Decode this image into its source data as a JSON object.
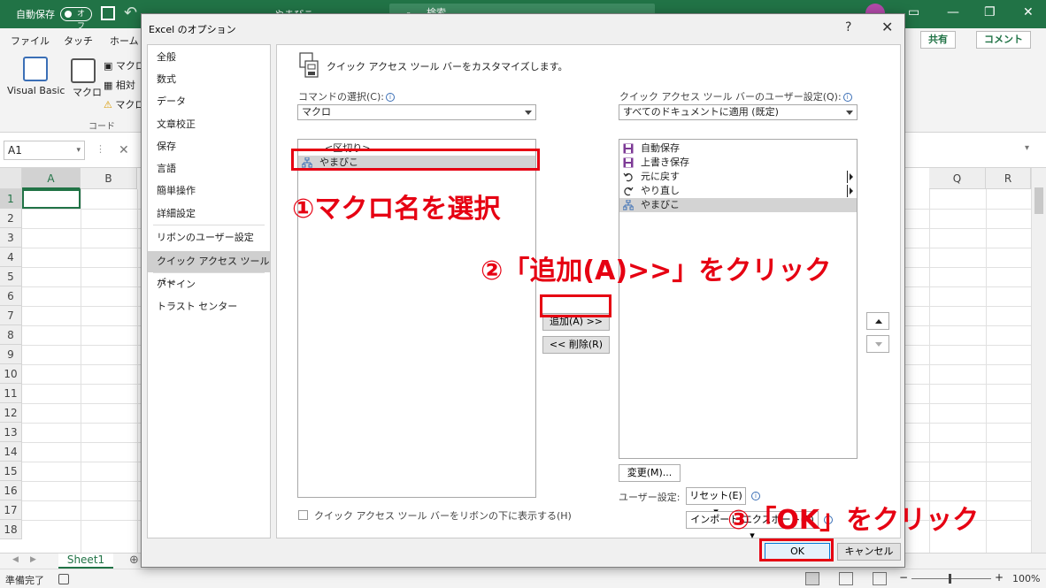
{
  "excel": {
    "autosave_label": "自動保存",
    "autosave_state": "オフ",
    "document_name": "やまびこ",
    "search_placeholder": "検索",
    "ribbon_tabs": [
      "ファイル",
      "タッチ",
      "ホーム"
    ],
    "share_label": "共有",
    "comment_label": "コメント",
    "ribbon_items": {
      "visual_basic": "Visual Basic",
      "macro": "マクロ",
      "macro_record": "マクロ",
      "relative": "相対",
      "macro_security": "マクロ"
    },
    "group_label": "コード",
    "name_box": "A1",
    "columns": [
      "A",
      "B",
      "Q",
      "R"
    ],
    "rows": [
      "1",
      "2",
      "3",
      "4",
      "5",
      "6",
      "7",
      "8",
      "9",
      "10",
      "11",
      "12",
      "13",
      "14",
      "15",
      "16",
      "17",
      "18"
    ],
    "sheet_tab": "Sheet1",
    "status_text": "準備完了",
    "zoom_level": "100%"
  },
  "dialog": {
    "title": "Excel のオプション",
    "help_glyph": "?",
    "close_glyph": "✕",
    "nav_items": [
      "全般",
      "数式",
      "データ",
      "文章校正",
      "保存",
      "言語",
      "簡単操作",
      "詳細設定",
      "リボンのユーザー設定",
      "クイック アクセス ツール バー",
      "アドイン",
      "トラスト センター"
    ],
    "active_nav": "クイック アクセス ツール バー",
    "heading": "クイック アクセス ツール バーをカスタマイズします。",
    "choose_commands_label": "コマンドの選択(C):",
    "choose_commands_value": "マクロ",
    "customize_label": "クイック アクセス ツール バーのユーザー設定(Q):",
    "customize_value": "すべてのドキュメントに適用 (既定)",
    "left_list": [
      {
        "text": "<区切り>",
        "icon": "none"
      },
      {
        "text": "やまびこ",
        "icon": "macro-icon"
      }
    ],
    "right_list": [
      {
        "text": "自動保存",
        "icon": "save-icon"
      },
      {
        "text": "上書き保存",
        "icon": "save-icon"
      },
      {
        "text": "元に戻す",
        "icon": "undo-icon"
      },
      {
        "text": "やり直し",
        "icon": "redo-icon"
      },
      {
        "text": "やまびこ",
        "icon": "macro-icon"
      }
    ],
    "add_button": "追加(A) >>",
    "remove_button": "<< 削除(R)",
    "modify_button": "変更(M)...",
    "user_settings_label": "ユーザー設定:",
    "reset_button": "リセット(E) ▾",
    "import_export_button": "インポート/エクスポート(P) ▾",
    "show_below_ribbon_label": "クイック アクセス ツール バーをリボンの下に表示する(H)",
    "ok_button": "OK",
    "cancel_button": "キャンセル"
  },
  "annotations": {
    "step1": "①マクロ名を選択",
    "step2": "②「追加(A)>>」をクリック",
    "step3": "③「OK」をクリック",
    "highlight_color": "#e60012"
  },
  "colors": {
    "excel_green": "#217346",
    "dialog_bg": "#f0f0f0",
    "selection_gray": "#d3d3d3"
  }
}
